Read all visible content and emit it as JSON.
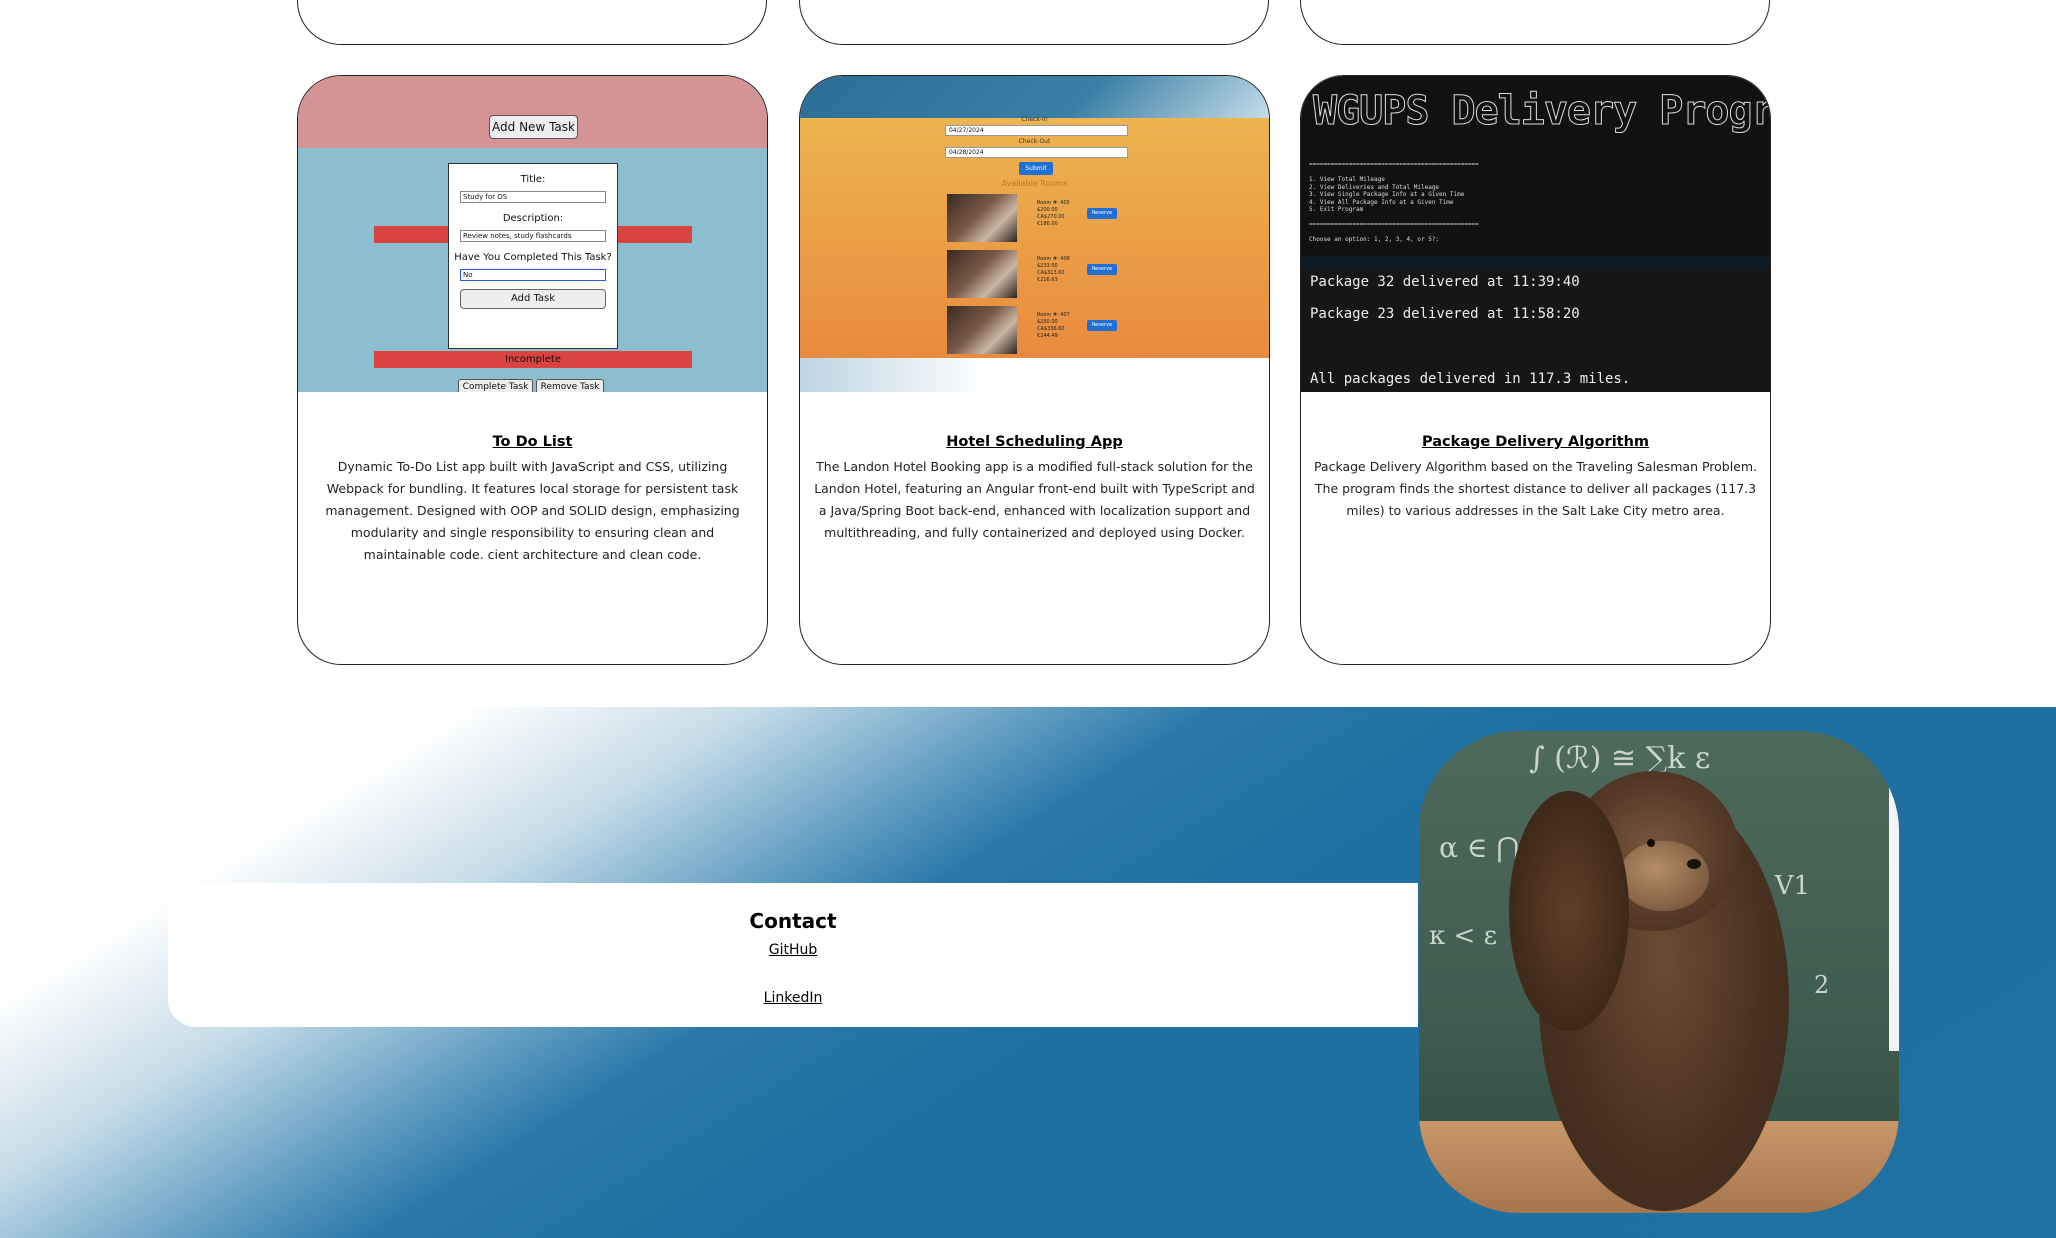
{
  "projects": [
    {
      "title": "To Do List",
      "description": "Dynamic To-Do List app built with JavaScript and CSS, utilizing Webpack for bundling. It features local storage for persistent task management. Designed with OOP and SOLID design, emphasizing modularity and single responsibility to ensuring clean and maintainable code. cient architecture and clean code.",
      "screenshot": {
        "add_new_task": "Add New Task",
        "title_label": "Title:",
        "title_value": "Study for OS",
        "description_label": "Description:",
        "description_value": "Review notes, study flashcards",
        "completed_label": "Have You Completed This Task?",
        "completed_value": "No",
        "add_task": "Add Task",
        "status": "Incomplete",
        "complete_task": "Complete Task",
        "remove_task": "Remove Task"
      }
    },
    {
      "title": "Hotel Scheduling App",
      "description": "The Landon Hotel Booking app is a modified full-stack solution for the Landon Hotel, featuring an Angular front-end built with TypeScript and a Java/Spring Boot back-end, enhanced with localization support and multithreading, and fully containerized and deployed using Docker.",
      "screenshot": {
        "check_in_label": "Check-In",
        "check_in_value": "04/27/2024",
        "check_out_label": "Check-Out",
        "check_out_value": "04/28/2024",
        "submit": "Submit",
        "available_rooms": "Available Rooms",
        "reserve": "Reserve",
        "rooms": [
          {
            "line1": "Room #: 405",
            "line2": "$200.00",
            "line3": "CA$270.00",
            "line4": "€186.00"
          },
          {
            "line1": "Room #: 406",
            "line2": "$233.00",
            "line3": "CA$313.60",
            "line4": "€216.63"
          },
          {
            "line1": "Room #: 407",
            "line2": "$250.00",
            "line3": "CA$336.60",
            "line4": "€244.49"
          }
        ]
      }
    },
    {
      "title": "Package Delivery Algorithm",
      "description": "Package Delivery Algorithm based on the Traveling Salesman Problem. The program finds the shortest distance to deliver all packages (117.3 miles) to various addresses in the Salt Lake City metro area.",
      "screenshot": {
        "banner": "WGUPS Delivery Program",
        "menu": "===============================================\n\n1. View Total Mileage\n2. View Deliveries and Total Mileage\n3. View Single Package Info at a Given Time\n4. View All Package Info at a Given Time\n5. Exit Program\n\n===============================================\n\nChoose an option: 1, 2, 3, 4, or 5?:",
        "line1": "Package 32 delivered at 11:39:40",
        "line2": "Package 23 delivered at 11:58:20",
        "line3": "All packages delivered in 117.3 miles."
      }
    }
  ],
  "contact": {
    "title": "Contact",
    "github": "GitHub",
    "linkedin": "LinkedIn"
  },
  "colors": {
    "footer_blue": "#1f71a3",
    "todo_pink": "#d49495",
    "todo_blue": "#8bbfcf",
    "hotel_orange": "#e98a3e",
    "terminal_black": "#161616"
  }
}
